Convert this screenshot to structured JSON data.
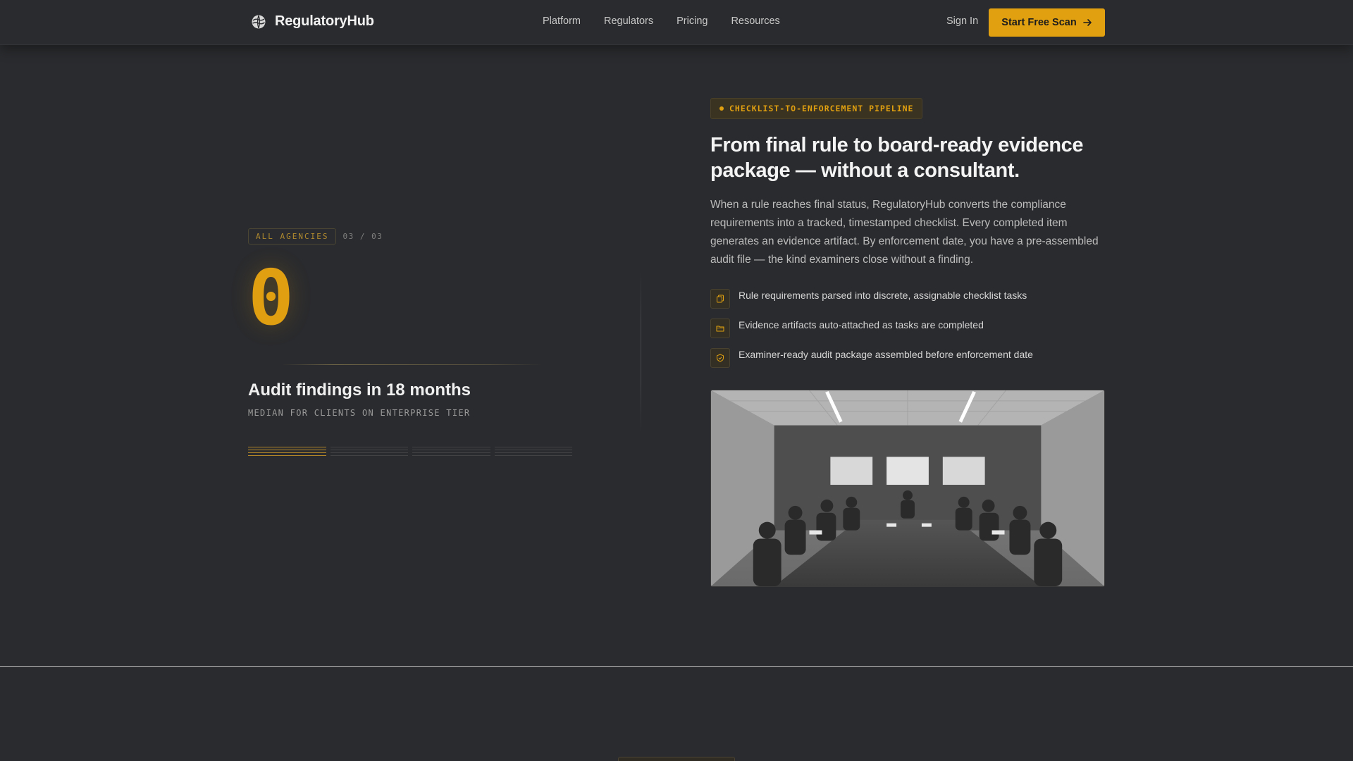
{
  "nav": {
    "brand": "RegulatoryHub",
    "links": [
      "Platform",
      "Regulators",
      "Pricing",
      "Resources"
    ],
    "signin": "Sign In",
    "cta": "Start Free Scan"
  },
  "stat": {
    "agency_badge": "ALL AGENCIES",
    "counter": "03 / 03",
    "value": "0",
    "title": "Audit findings in 18 months",
    "subtitle": "MEDIAN FOR CLIENTS ON ENTERPRISE TIER",
    "progress_segments": 4,
    "progress_active_index": 0
  },
  "pipeline": {
    "tag": "CHECKLIST-TO-ENFORCEMENT PIPELINE",
    "headline": "From final rule to board-ready evidence package — without a consultant.",
    "lead": "When a rule reaches final status, RegulatoryHub converts the compliance requirements into a tracked, timestamped checklist. Every completed item generates an evidence artifact. By enforcement date, you have a pre-assembled audit file — the kind examiners close without a finding.",
    "features": [
      {
        "icon": "copy-icon",
        "text": "Rule requirements parsed into discrete, assignable checklist tasks"
      },
      {
        "icon": "folder-icon",
        "text": "Evidence artifacts auto-attached as tasks are completed"
      },
      {
        "icon": "shield-icon",
        "text": "Examiner-ready audit package assembled before enforcement date"
      }
    ]
  },
  "colors": {
    "accent": "#e1a00f",
    "background": "#2a2b2e"
  }
}
